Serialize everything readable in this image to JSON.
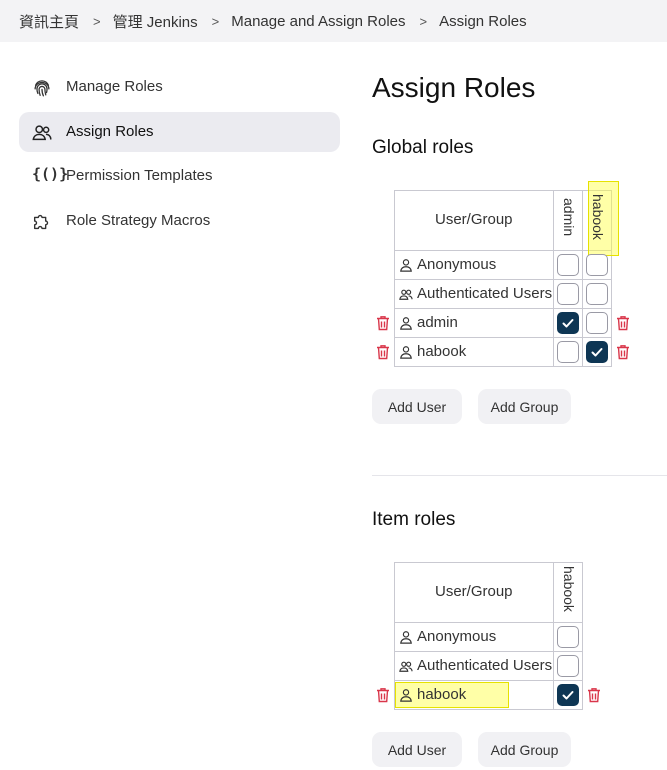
{
  "breadcrumb": [
    "資訊主頁",
    "管理 Jenkins",
    "Manage and Assign Roles",
    "Assign Roles"
  ],
  "sidebar": {
    "items": [
      {
        "label": "Manage Roles",
        "icon": "fingerprint-icon"
      },
      {
        "label": "Assign Roles",
        "icon": "users-icon",
        "active": true
      },
      {
        "label": "Permission Templates",
        "icon": "braces-icon"
      },
      {
        "label": "Role Strategy Macros",
        "icon": "puzzle-icon"
      }
    ]
  },
  "page": {
    "title": "Assign Roles"
  },
  "global_roles": {
    "title": "Global roles",
    "header": "User/Group",
    "roles": [
      "admin",
      "habook"
    ],
    "rows": [
      {
        "name": "Anonymous",
        "type": "user",
        "checks": [
          false,
          false
        ]
      },
      {
        "name": "Authenticated Users",
        "type": "group",
        "checks": [
          false,
          false
        ]
      },
      {
        "name": "admin",
        "type": "user",
        "checks": [
          true,
          false
        ]
      },
      {
        "name": "habook",
        "type": "user",
        "checks": [
          false,
          true
        ]
      }
    ],
    "add_user": "Add User",
    "add_group": "Add Group"
  },
  "item_roles": {
    "title": "Item roles",
    "header": "User/Group",
    "roles": [
      "habook"
    ],
    "rows": [
      {
        "name": "Anonymous",
        "type": "user",
        "checks": [
          false
        ]
      },
      {
        "name": "Authenticated Users",
        "type": "group",
        "checks": [
          false
        ]
      },
      {
        "name": "habook",
        "type": "user",
        "checks": [
          true
        ]
      }
    ],
    "add_user": "Add User",
    "add_group": "Add Group"
  },
  "colors": {
    "checked": "#0e3654",
    "trash": "#d9364a",
    "highlight": "#ffff3c"
  }
}
